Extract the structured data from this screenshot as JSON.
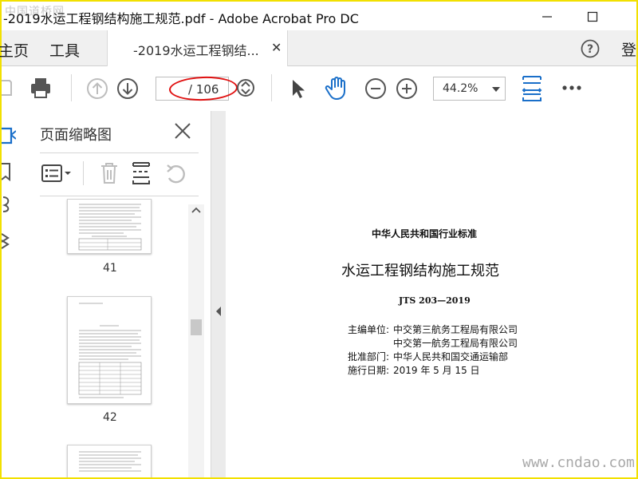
{
  "window": {
    "title": "-2019水运工程钢结构施工规范.pdf - Adobe Acrobat Pro DC",
    "watermark_top": "中国道桥网"
  },
  "menubar": {
    "home": "主页",
    "tools": "工具",
    "doc_tab": "-2019水运工程钢结...",
    "close_tab": "✕",
    "login": "登"
  },
  "toolbar": {
    "page_total": "/ 106",
    "zoom": "44.2%"
  },
  "thumbnail_panel": {
    "title": "页面缩略图",
    "pages": [
      "41",
      "42"
    ]
  },
  "document": {
    "subtitle": "中华人民共和国行业标准",
    "title": "水运工程钢结构施工规范",
    "code": "JTS 203—2019",
    "editor_label": "主编单位:",
    "editor1": "中交第三航务工程局有限公司",
    "editor2": "中交第一航务工程局有限公司",
    "approver_label": "批准部门:",
    "approver": "中华人民共和国交通运输部",
    "date_label": "施行日期:",
    "date": "2019 年 5 月 15 日"
  },
  "watermark_bottom": "www.cndao.com",
  "colors": {
    "frame": "#f2e000",
    "accent_blue": "#1a6fc9",
    "annotation_red": "#e01010"
  }
}
